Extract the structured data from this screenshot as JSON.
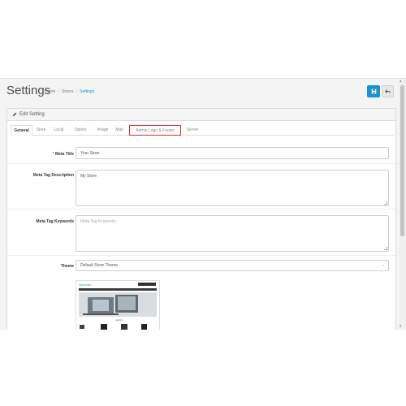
{
  "header": {
    "title": "Settings",
    "breadcrumb": [
      "Home",
      "Stores",
      "Settings"
    ]
  },
  "panel": {
    "heading": "Edit Setting"
  },
  "tabs": [
    "General",
    "Store",
    "Local",
    "Option",
    "Image",
    "Mail",
    "Admin Logo & Footer",
    "Server"
  ],
  "form": {
    "meta_title": {
      "label": "Meta Title",
      "required": "*",
      "value": "Your Store"
    },
    "meta_description": {
      "label": "Meta Tag Description",
      "value": "My Store"
    },
    "meta_keywords": {
      "label": "Meta Tag Keywords",
      "placeholder": "Meta Tag Keywords"
    },
    "theme": {
      "label": "Theme",
      "value": "Default Store Theme"
    }
  },
  "thumbnail": {
    "brand": "opencart",
    "caption": "Laptops"
  },
  "colors": {
    "accent": "#1e91cf",
    "highlight": "#e03030"
  },
  "icons": [
    "pencil-icon",
    "save-icon",
    "reply-icon",
    "chevron-down-icon"
  ]
}
